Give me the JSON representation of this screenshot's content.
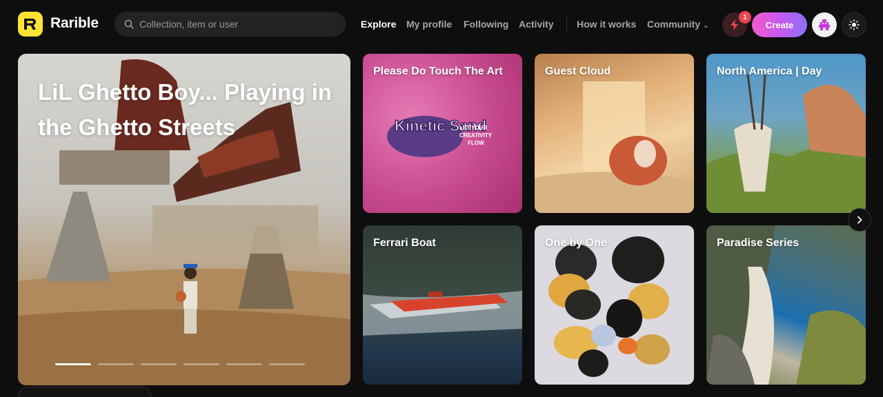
{
  "brand": {
    "name": "Rarible",
    "logo_letter": "R",
    "logo_color": "#fee335"
  },
  "search": {
    "placeholder": "Collection, item or user"
  },
  "nav": {
    "items": [
      "Explore",
      "My profile",
      "Following",
      "Activity",
      "How it works",
      "Community"
    ],
    "active": "Explore"
  },
  "header": {
    "notifications_count": "1",
    "create_label": "Create",
    "create_gradient": [
      "#f25acd",
      "#8c6ff7"
    ]
  },
  "hero": {
    "title": "LiL Ghetto Boy... Playing in the Ghetto Streets",
    "slides": 6,
    "active_slide": 1
  },
  "cards": [
    {
      "title": "Please Do Touch The Art",
      "art_text": "Kinetic Sand",
      "art_subtext": "LET YOUR CREATIVITY FLOW"
    },
    {
      "title": "Guest Cloud"
    },
    {
      "title": "North America | Day"
    },
    {
      "title": "Ferrari Boat"
    },
    {
      "title": "One by One"
    },
    {
      "title": "Paradise Series"
    }
  ],
  "icons": {
    "search": "search-icon",
    "bolt": "bolt-icon",
    "theme": "sun-icon",
    "next": "chevron-right-icon",
    "avatar": "avatar-icon"
  }
}
